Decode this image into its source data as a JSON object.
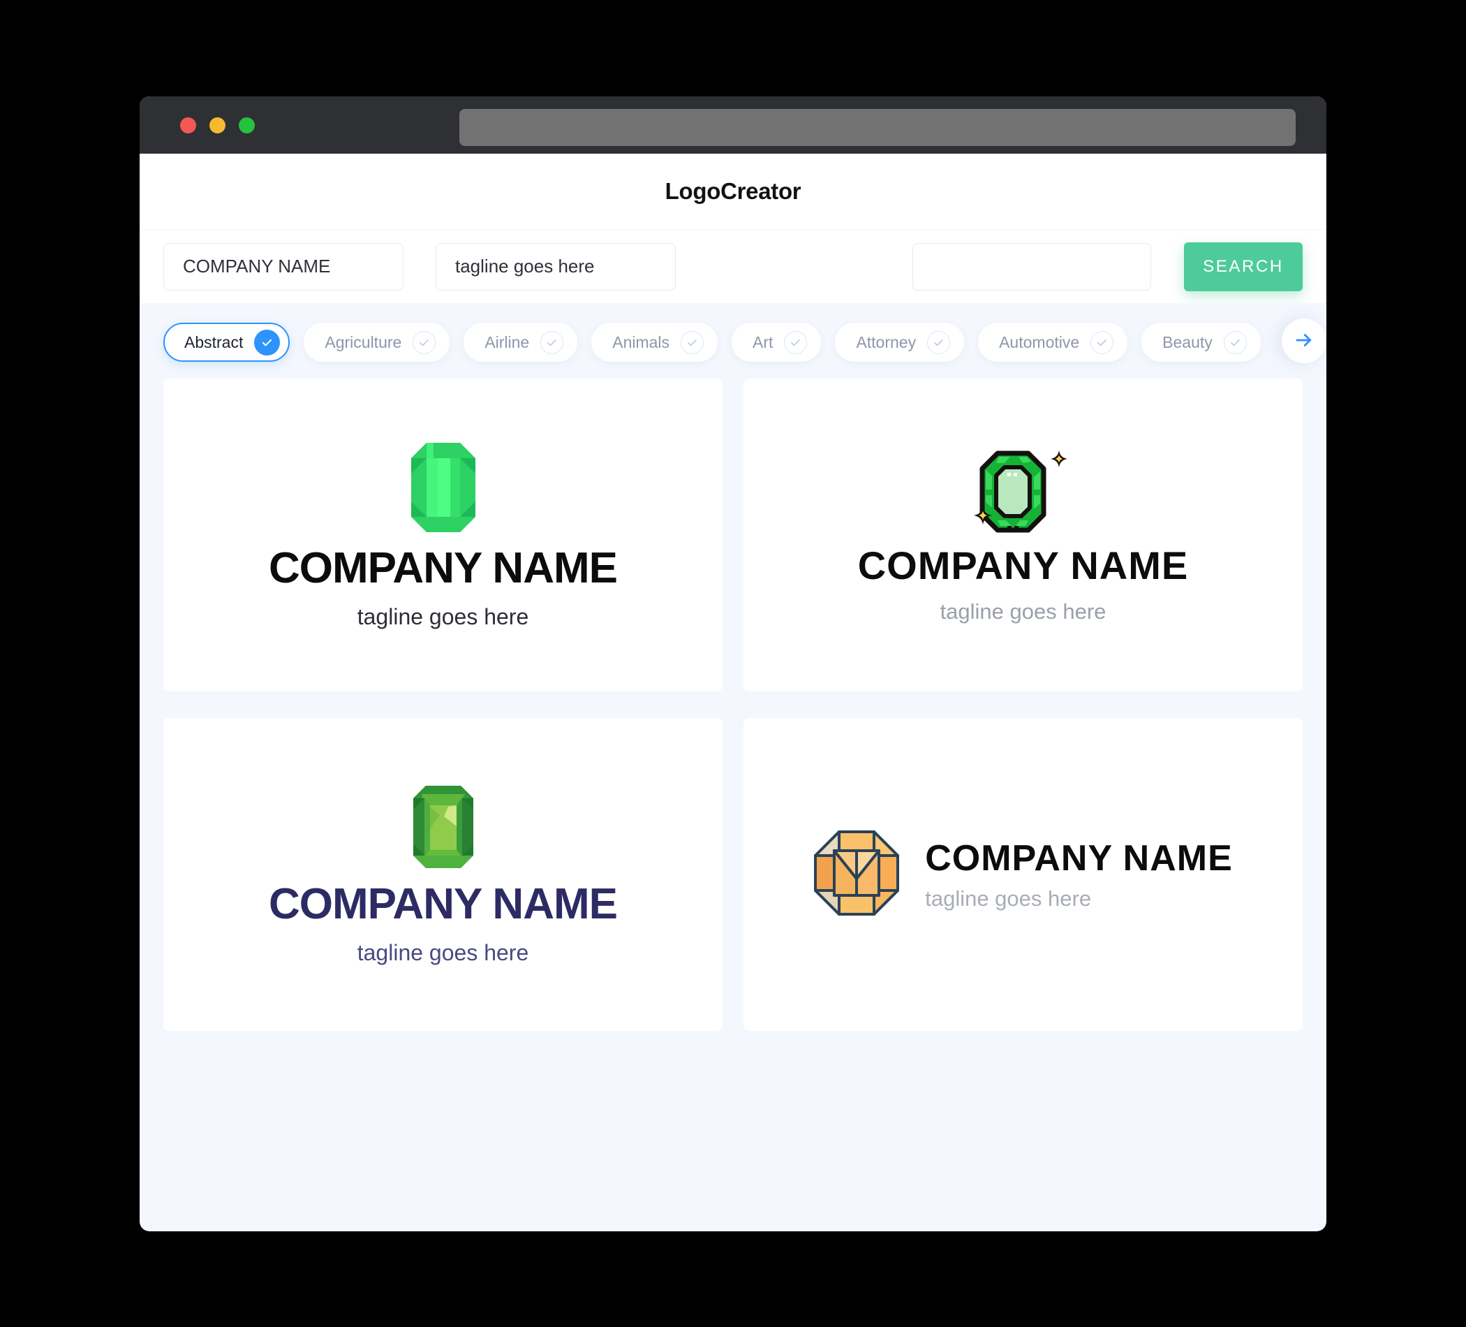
{
  "window": {
    "traffic_lights": [
      "close",
      "minimize",
      "zoom"
    ],
    "url_value": ""
  },
  "header": {
    "title": "LogoCreator"
  },
  "search": {
    "company_value": "COMPANY NAME",
    "company_placeholder": "COMPANY NAME",
    "tagline_value": "tagline goes here",
    "tagline_placeholder": "tagline goes here",
    "extra_value": "",
    "extra_placeholder": "",
    "button_label": "SEARCH",
    "button_color": "#4ecb9b"
  },
  "categories": {
    "active_color": "#2e93fb",
    "next_icon": "arrow-right-icon",
    "items": [
      {
        "label": "Abstract",
        "selected": true,
        "icon": "check-icon"
      },
      {
        "label": "Agriculture",
        "selected": false,
        "icon": "check-icon"
      },
      {
        "label": "Airline",
        "selected": false,
        "icon": "check-icon"
      },
      {
        "label": "Animals",
        "selected": false,
        "icon": "check-icon"
      },
      {
        "label": "Art",
        "selected": false,
        "icon": "check-icon"
      },
      {
        "label": "Attorney",
        "selected": false,
        "icon": "check-icon"
      },
      {
        "label": "Automotive",
        "selected": false,
        "icon": "check-icon"
      },
      {
        "label": "Beauty",
        "selected": false,
        "icon": "check-icon"
      }
    ]
  },
  "results": [
    {
      "id": "logo-1",
      "company": "COMPANY NAME",
      "tagline": "tagline goes here",
      "icon": "emerald-gem-icon",
      "layout": "stacked",
      "text_color": "#0b0c0e",
      "tagline_color": "#2c2f36",
      "gem_color": "#35e06a"
    },
    {
      "id": "logo-2",
      "company": "COMPANY NAME",
      "tagline": "tagline goes here",
      "icon": "emerald-gem-outline-sparkle-icon",
      "layout": "stacked",
      "text_color": "#0b0c0e",
      "tagline_color": "#9aa0aa",
      "gem_color": "#17b93c",
      "sparkle_color": "#ffd64a"
    },
    {
      "id": "logo-3",
      "company": "COMPANY NAME",
      "tagline": "tagline goes here",
      "icon": "emerald-gem-faceted-icon",
      "layout": "stacked",
      "text_color": "#2d2b63",
      "tagline_color": "#4a4a80",
      "gem_color": "#8cc63f"
    },
    {
      "id": "logo-4",
      "company": "COMPANY NAME",
      "tagline": "tagline goes here",
      "icon": "octagon-gem-icon",
      "layout": "horizontal",
      "text_color": "#0b0c0e",
      "tagline_color": "#a8adb5",
      "gem_color": "#f6ad55"
    }
  ]
}
